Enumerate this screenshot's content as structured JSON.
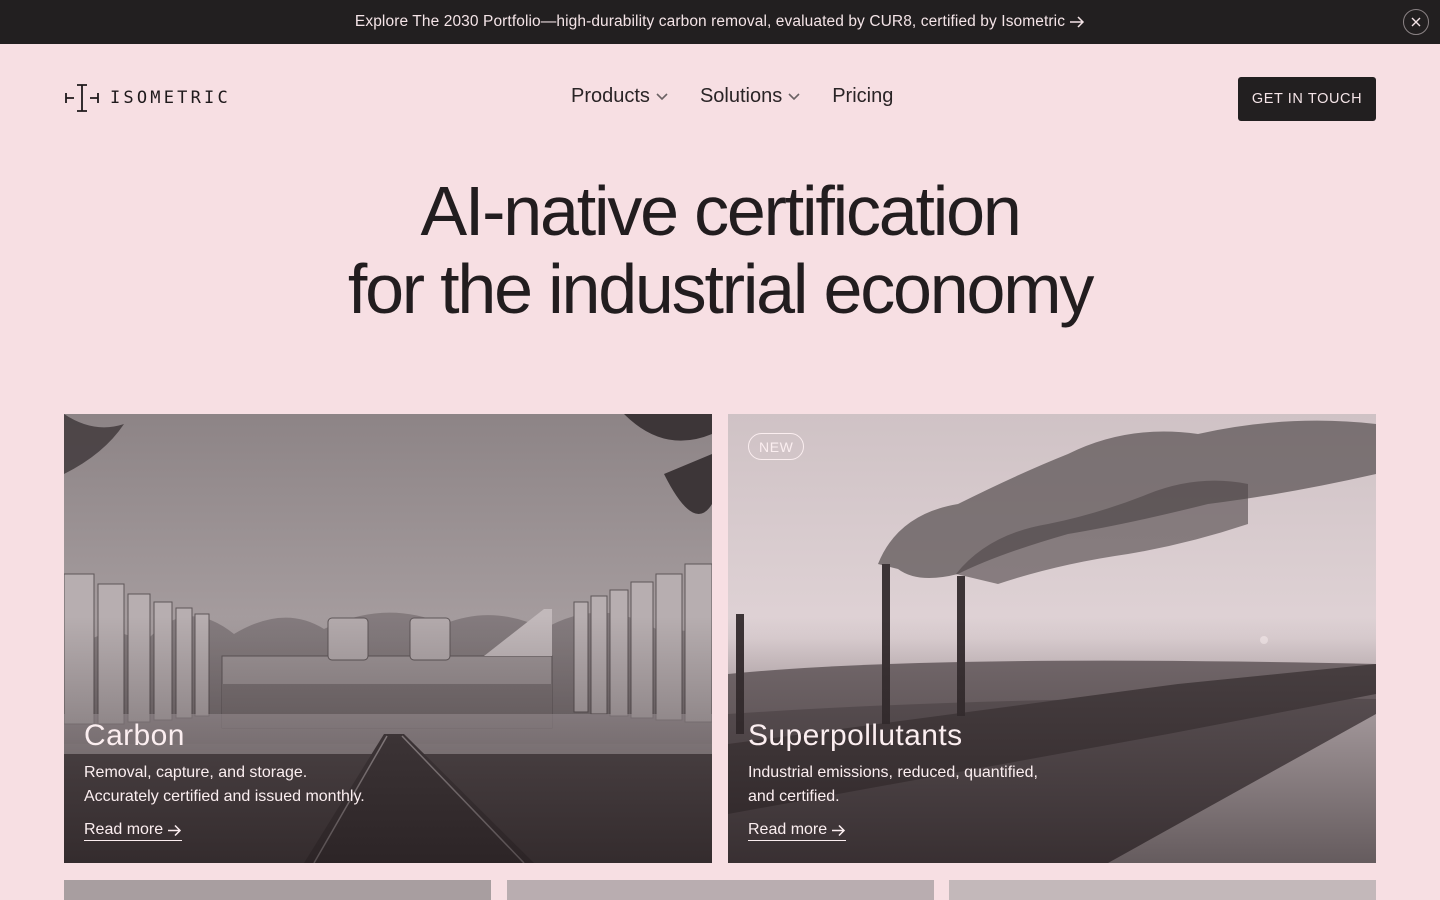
{
  "announcement": {
    "text": "Explore The 2030 Portfolio—high-durability carbon removal, evaluated by CUR8, certified by Isometric",
    "arrow_icon": "arrow-right-icon",
    "close_icon": "close-icon"
  },
  "header": {
    "logo_text": "ISOMETRIC",
    "nav": [
      {
        "label": "Products",
        "has_dropdown": true
      },
      {
        "label": "Solutions",
        "has_dropdown": true
      },
      {
        "label": "Pricing",
        "has_dropdown": false
      }
    ],
    "cta_label": "GET IN TOUCH"
  },
  "hero": {
    "line1": "AI-native certification",
    "line2": "for the industrial economy"
  },
  "cards": [
    {
      "title": "Carbon",
      "description_line1": "Removal, capture, and storage.",
      "description_line2": "Accurately certified and issued monthly.",
      "link": "Read more"
    },
    {
      "badge": "NEW",
      "title": "Superpollutants",
      "description_line1": "Industrial emissions, reduced, quantified,",
      "description_line2": "and certified.",
      "link": "Read more"
    }
  ],
  "colors": {
    "background": "#f7dfe3",
    "dark": "#221f20",
    "text_light": "#fbeef0"
  }
}
